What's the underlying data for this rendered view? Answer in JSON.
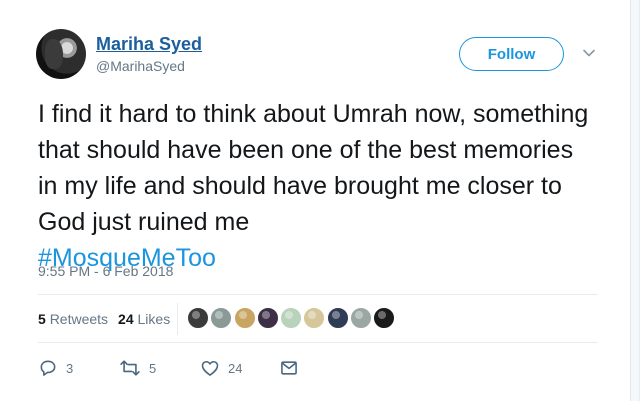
{
  "user": {
    "display_name": "Mariha Syed",
    "handle": "@MarihaSyed",
    "avatar_icon": "profile-photo"
  },
  "follow_label": "Follow",
  "tweet": {
    "text": "I find it hard to think about Umrah now, something that should have been one of the best memories in my life and should have brought me closer to God just ruined me",
    "hashtag": "#MosqueMeToo"
  },
  "timestamp": "9:55 PM - 6 Feb 2018",
  "stats": {
    "retweets_count": "5",
    "retweets_label": "Retweets",
    "likes_count": "24",
    "likes_label": "Likes"
  },
  "likers": [
    {
      "color": "#3b3b3b"
    },
    {
      "color": "#8a9a97"
    },
    {
      "color": "#c8a560"
    },
    {
      "color": "#3d2f45"
    },
    {
      "color": "#b8d2bb"
    },
    {
      "color": "#d6c79a"
    },
    {
      "color": "#2f3c56"
    },
    {
      "color": "#9ba7a3"
    },
    {
      "color": "#1a1a1a"
    }
  ],
  "actions": {
    "reply_count": "3",
    "retweet_count": "5",
    "like_count": "24"
  },
  "colors": {
    "name_link": "#1b5f9e",
    "accent": "#1b95e0",
    "muted": "#657786"
  }
}
